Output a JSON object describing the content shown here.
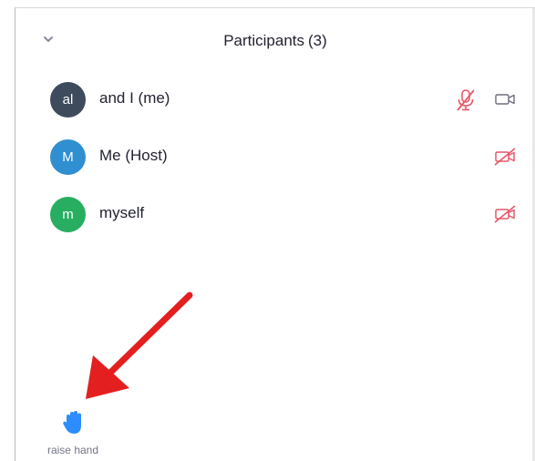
{
  "panel": {
    "title": "Participants",
    "count": "(3)"
  },
  "participants": [
    {
      "initials": "al",
      "name": "and I (me)",
      "avatar_color": "#3d4b5c",
      "mic": "muted",
      "video": "off-neutral"
    },
    {
      "initials": "M",
      "name": "Me (Host)",
      "avatar_color": "#2f8fd1",
      "mic": "none",
      "video": "off"
    },
    {
      "initials": "m",
      "name": "myself",
      "avatar_color": "#27ae60",
      "mic": "none",
      "video": "off"
    }
  ],
  "footer": {
    "raise_hand_label": "raise hand",
    "raise_hand_icon": "raised-hand-icon"
  },
  "colors": {
    "muted_red": "#e8586a",
    "raise_hand_blue": "#2d8cff",
    "annotation_arrow": "#e31f1f"
  }
}
